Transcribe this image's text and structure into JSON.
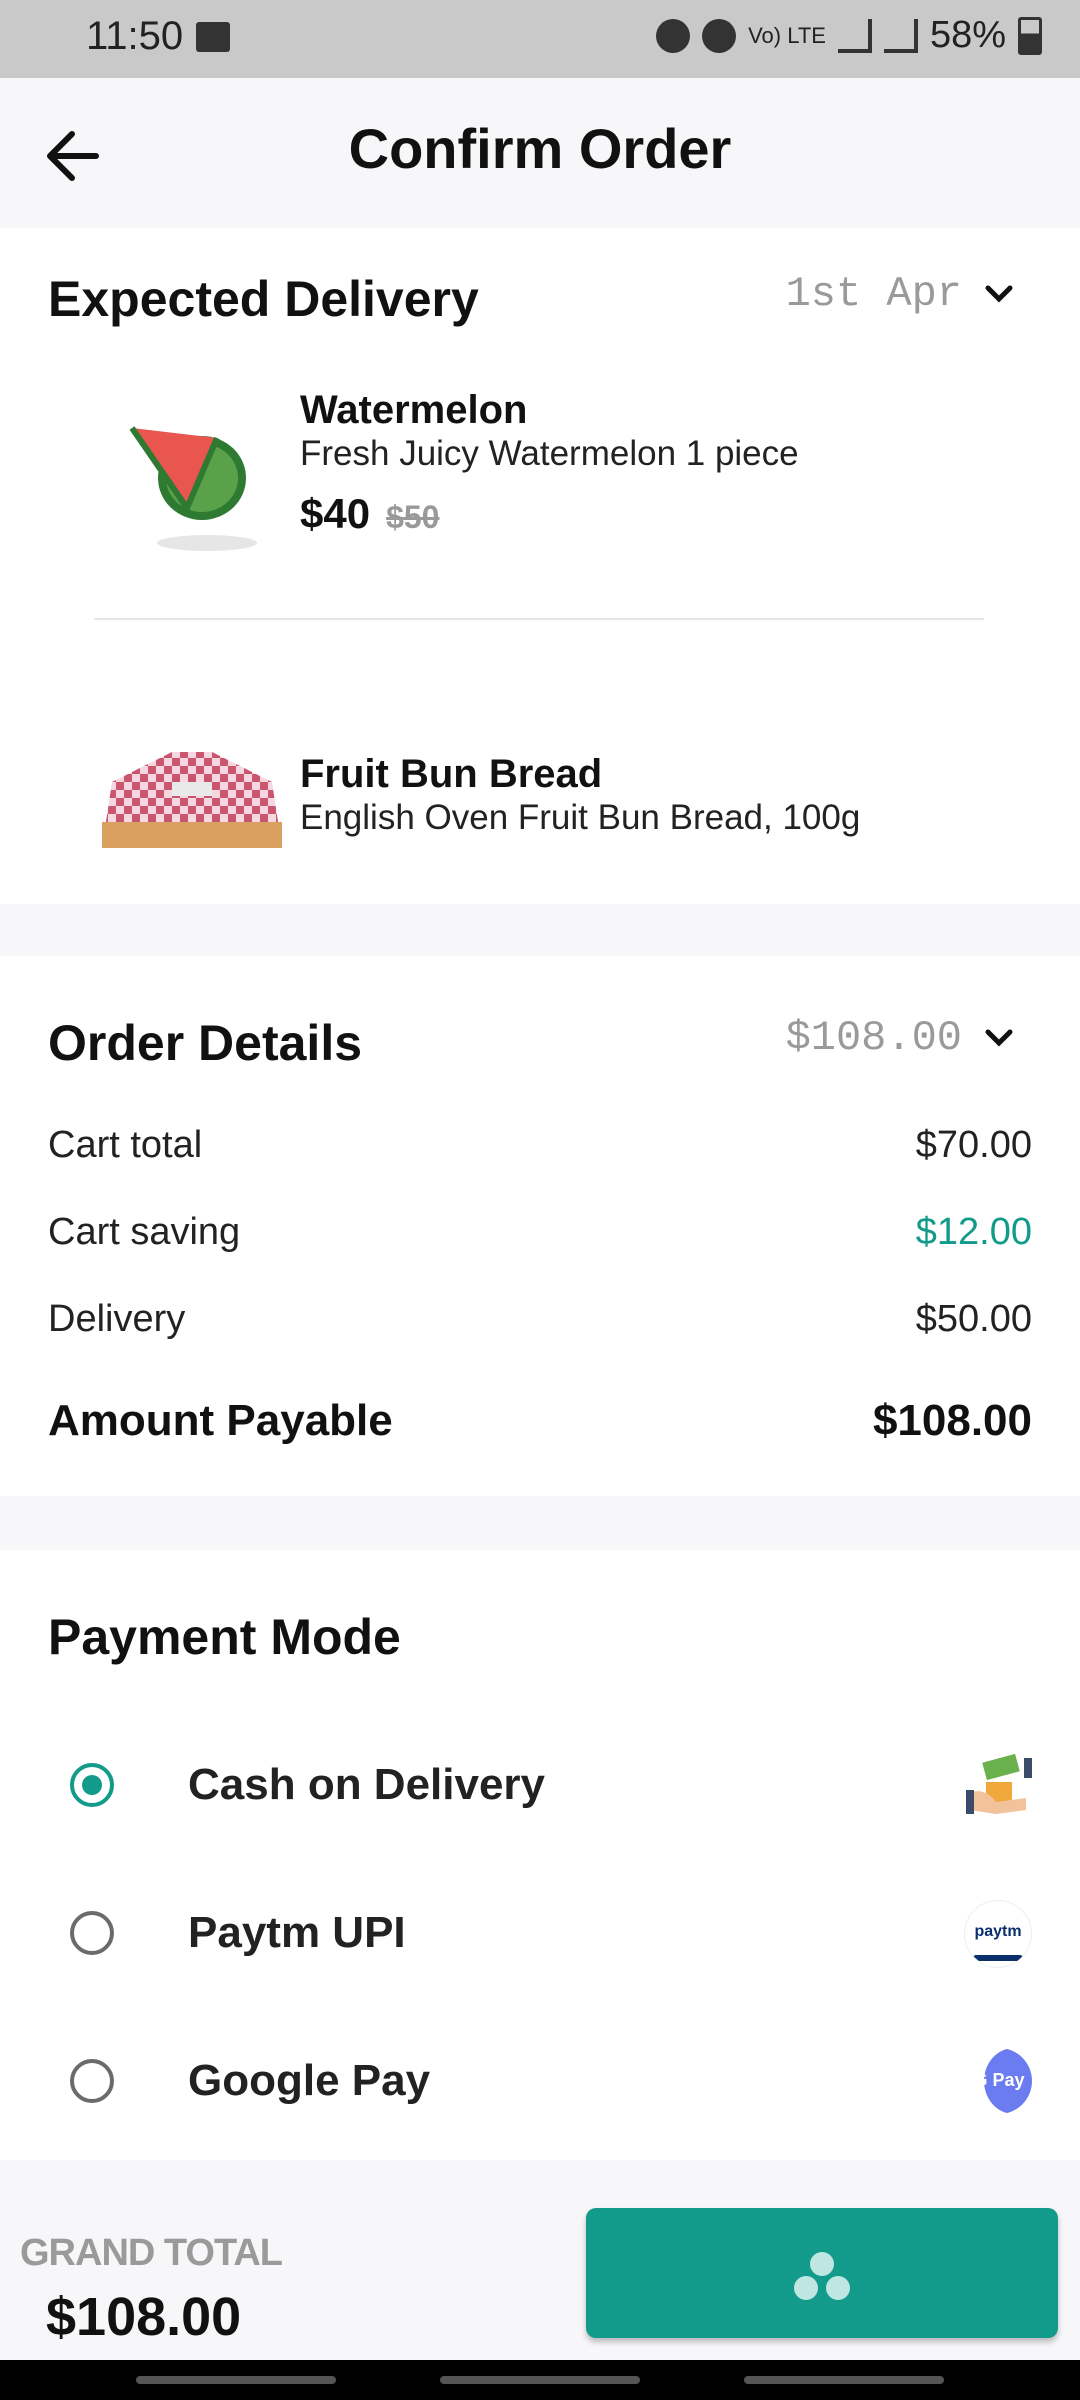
{
  "status_bar": {
    "time": "11:50",
    "net_text": "Vo) LTE",
    "battery": "58%"
  },
  "header": {
    "title": "Confirm Order"
  },
  "delivery": {
    "title": "Expected Delivery",
    "date": "1st Apr",
    "items": [
      {
        "name": "Watermelon",
        "desc": "Fresh Juicy Watermelon 1 piece",
        "price": "$40",
        "mrp": "$50"
      },
      {
        "name": "Fruit Bun Bread",
        "desc": "English Oven Fruit Bun Bread, 100g"
      }
    ]
  },
  "order_details": {
    "title": "Order Details",
    "total_summary": "$108.00",
    "rows": [
      {
        "label": "Cart total",
        "value": "$70.00"
      },
      {
        "label": "Cart saving",
        "value": "$12.00"
      },
      {
        "label": "Delivery",
        "value": "$50.00"
      }
    ],
    "payable_label": "Amount Payable",
    "payable_value": "$108.00"
  },
  "payment": {
    "title": "Payment Mode",
    "options": [
      {
        "label": "Cash on Delivery",
        "selected": true,
        "icon": "cash-icon"
      },
      {
        "label": "Paytm UPI",
        "selected": false,
        "icon": "paytm-icon",
        "logo_text": "paytm"
      },
      {
        "label": "Google Pay",
        "selected": false,
        "icon": "gpay-icon",
        "logo_text": "G Pay"
      }
    ]
  },
  "footer": {
    "grand_total_label": "GRAND TOTAL",
    "grand_total_value": "$108.00",
    "button_state": "loading"
  },
  "colors": {
    "accent": "#129b8a",
    "saving": "#129b8a"
  }
}
